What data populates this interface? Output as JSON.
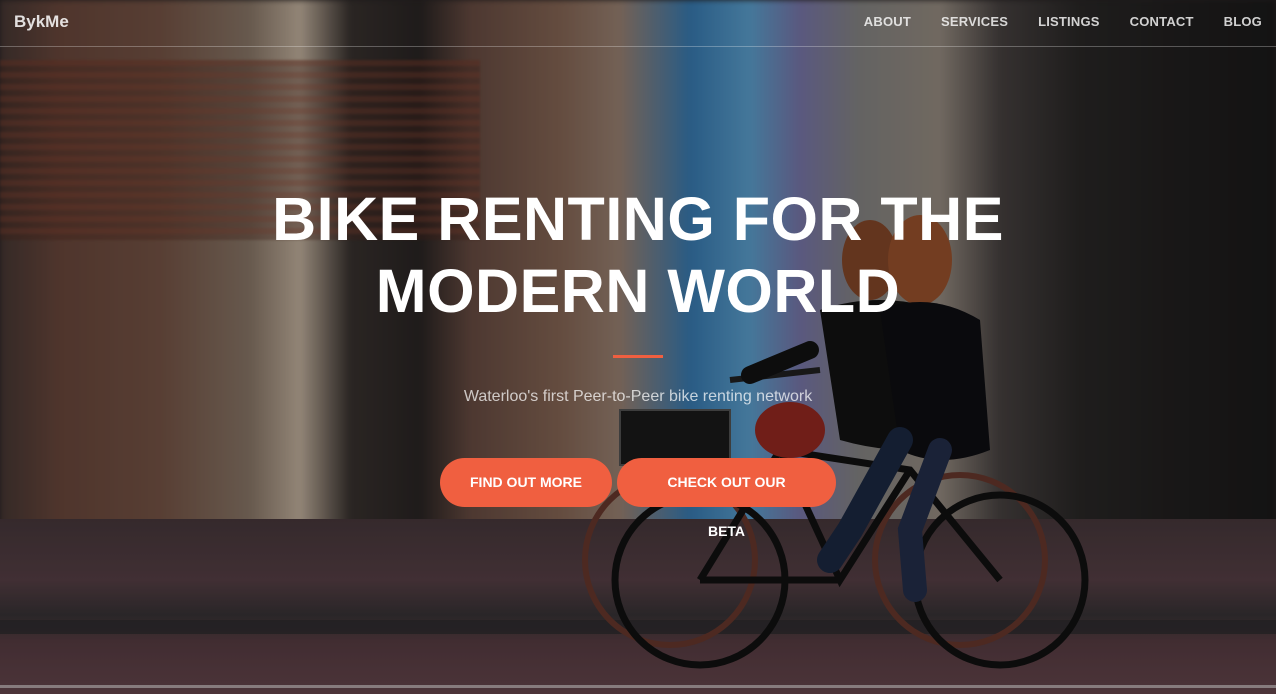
{
  "brand": "BykMe",
  "nav": {
    "items": [
      {
        "label": "ABOUT"
      },
      {
        "label": "SERVICES"
      },
      {
        "label": "LISTINGS"
      },
      {
        "label": "CONTACT"
      },
      {
        "label": "BLOG"
      }
    ]
  },
  "hero": {
    "headline_line1": "BIKE RENTING FOR THE",
    "headline_line2": "MODERN WORLD",
    "subtitle": "Waterloo's first Peer-to-Peer bike renting network",
    "buttons": {
      "find_out_more": "FIND OUT MORE",
      "check_out_beta": "CHECK OUT OUR BETA"
    }
  },
  "colors": {
    "accent": "#f05f40",
    "text": "#ffffff"
  }
}
